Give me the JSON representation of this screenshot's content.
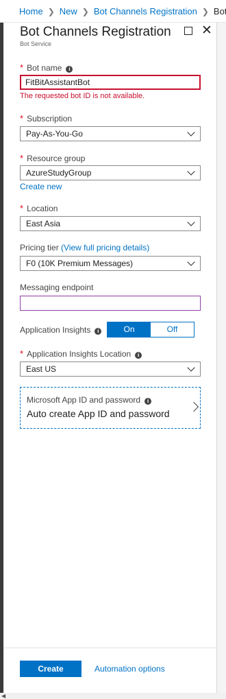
{
  "breadcrumb": {
    "items": [
      "Home",
      "New",
      "Bot Channels Registration"
    ],
    "current": "Bot C"
  },
  "blade": {
    "title": "Bot Channels Registration",
    "subtitle": "Bot Service",
    "maximize_icon": "maximize-icon",
    "close_icon": "✕"
  },
  "form": {
    "bot_name": {
      "label": "Bot name",
      "value": "FitBitAssistantBot",
      "error": "The requested bot ID is not available."
    },
    "subscription": {
      "label": "Subscription",
      "value": "Pay-As-You-Go"
    },
    "resource_group": {
      "label": "Resource group",
      "value": "AzureStudyGroup",
      "create_new": "Create new"
    },
    "location": {
      "label": "Location",
      "value": "East Asia"
    },
    "pricing_tier": {
      "label": "Pricing tier",
      "link": "(View full pricing details)",
      "value": "F0 (10K Premium Messages)"
    },
    "messaging_endpoint": {
      "label": "Messaging endpoint",
      "value": ""
    },
    "app_insights": {
      "label": "Application Insights",
      "on": "On",
      "off": "Off",
      "selected": "On"
    },
    "app_insights_location": {
      "label": "Application Insights Location",
      "value": "East US"
    },
    "app_id": {
      "label": "Microsoft App ID and password",
      "value": "Auto create App ID and password"
    },
    "required_mark": "*",
    "info_icon": "i"
  },
  "footer": {
    "create_label": "Create",
    "automation_label": "Automation options"
  },
  "colors": {
    "accent": "#0072c6",
    "error": "#c8102e",
    "required": "#e00b1c"
  },
  "scroll": {
    "left_arrow": "◀"
  }
}
